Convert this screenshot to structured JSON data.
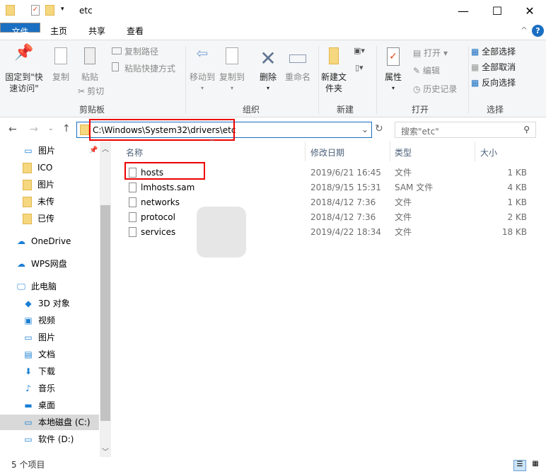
{
  "window": {
    "title": "etc",
    "minimize": "—",
    "maximize": "☐",
    "close": "✕"
  },
  "tabs": [
    {
      "label": "文件"
    },
    {
      "label": "主页"
    },
    {
      "label": "共享"
    },
    {
      "label": "查看"
    }
  ],
  "ribbon": {
    "pin": "固定到\"快速访问\"",
    "copy": "复制",
    "paste": "粘贴",
    "copy_path": "复制路径",
    "paste_shortcut": "粘贴快捷方式",
    "cut": "剪切",
    "move_to": "移动到",
    "copy_to": "复制到",
    "delete": "删除",
    "rename": "重命名",
    "new_folder": "新建文件夹",
    "properties": "属性",
    "open": "打开",
    "edit": "编辑",
    "history": "历史记录",
    "select_all": "全部选择",
    "select_none": "全部取消",
    "invert": "反向选择",
    "groups": {
      "clipboard": "剪贴板",
      "organize": "组织",
      "new": "新建",
      "open": "打开",
      "select": "选择"
    }
  },
  "address": {
    "path": "C:\\Windows\\System32\\drivers\\etc",
    "search_placeholder": "搜索\"etc\""
  },
  "nav": [
    {
      "label": "图片",
      "icon": "pictures-icon"
    },
    {
      "label": "ICO",
      "icon": "folder-icon"
    },
    {
      "label": "图片",
      "icon": "folder-icon"
    },
    {
      "label": "未传",
      "icon": "folder-icon"
    },
    {
      "label": "已传",
      "icon": "folder-icon"
    },
    {
      "label": "OneDrive",
      "icon": "cloud-icon"
    },
    {
      "label": "WPS网盘",
      "icon": "cloud-icon"
    },
    {
      "label": "此电脑",
      "icon": "computer-icon"
    },
    {
      "label": "3D 对象",
      "icon": "cube-icon"
    },
    {
      "label": "视频",
      "icon": "video-icon"
    },
    {
      "label": "图片",
      "icon": "pictures-icon"
    },
    {
      "label": "文档",
      "icon": "document-icon"
    },
    {
      "label": "下载",
      "icon": "download-icon"
    },
    {
      "label": "音乐",
      "icon": "music-icon"
    },
    {
      "label": "桌面",
      "icon": "desktop-icon"
    },
    {
      "label": "本地磁盘 (C:)",
      "icon": "drive-icon",
      "selected": true
    },
    {
      "label": "软件 (D:)",
      "icon": "drive-icon"
    }
  ],
  "columns": {
    "name": "名称",
    "date": "修改日期",
    "type": "类型",
    "size": "大小"
  },
  "files": [
    {
      "name": "hosts",
      "date": "2019/6/21 16:45",
      "type": "文件",
      "size": "1 KB"
    },
    {
      "name": "lmhosts.sam",
      "date": "2018/9/15 15:31",
      "type": "SAM 文件",
      "size": "4 KB"
    },
    {
      "name": "networks",
      "date": "2018/4/12 7:36",
      "type": "文件",
      "size": "1 KB"
    },
    {
      "name": "protocol",
      "date": "2018/4/12 7:36",
      "type": "文件",
      "size": "2 KB"
    },
    {
      "name": "services",
      "date": "2019/4/22 18:34",
      "type": "文件",
      "size": "18 KB"
    }
  ],
  "status": {
    "count": "5 个项目"
  },
  "colors": {
    "accent": "#1a6fc2",
    "highlight": "#e00000"
  }
}
